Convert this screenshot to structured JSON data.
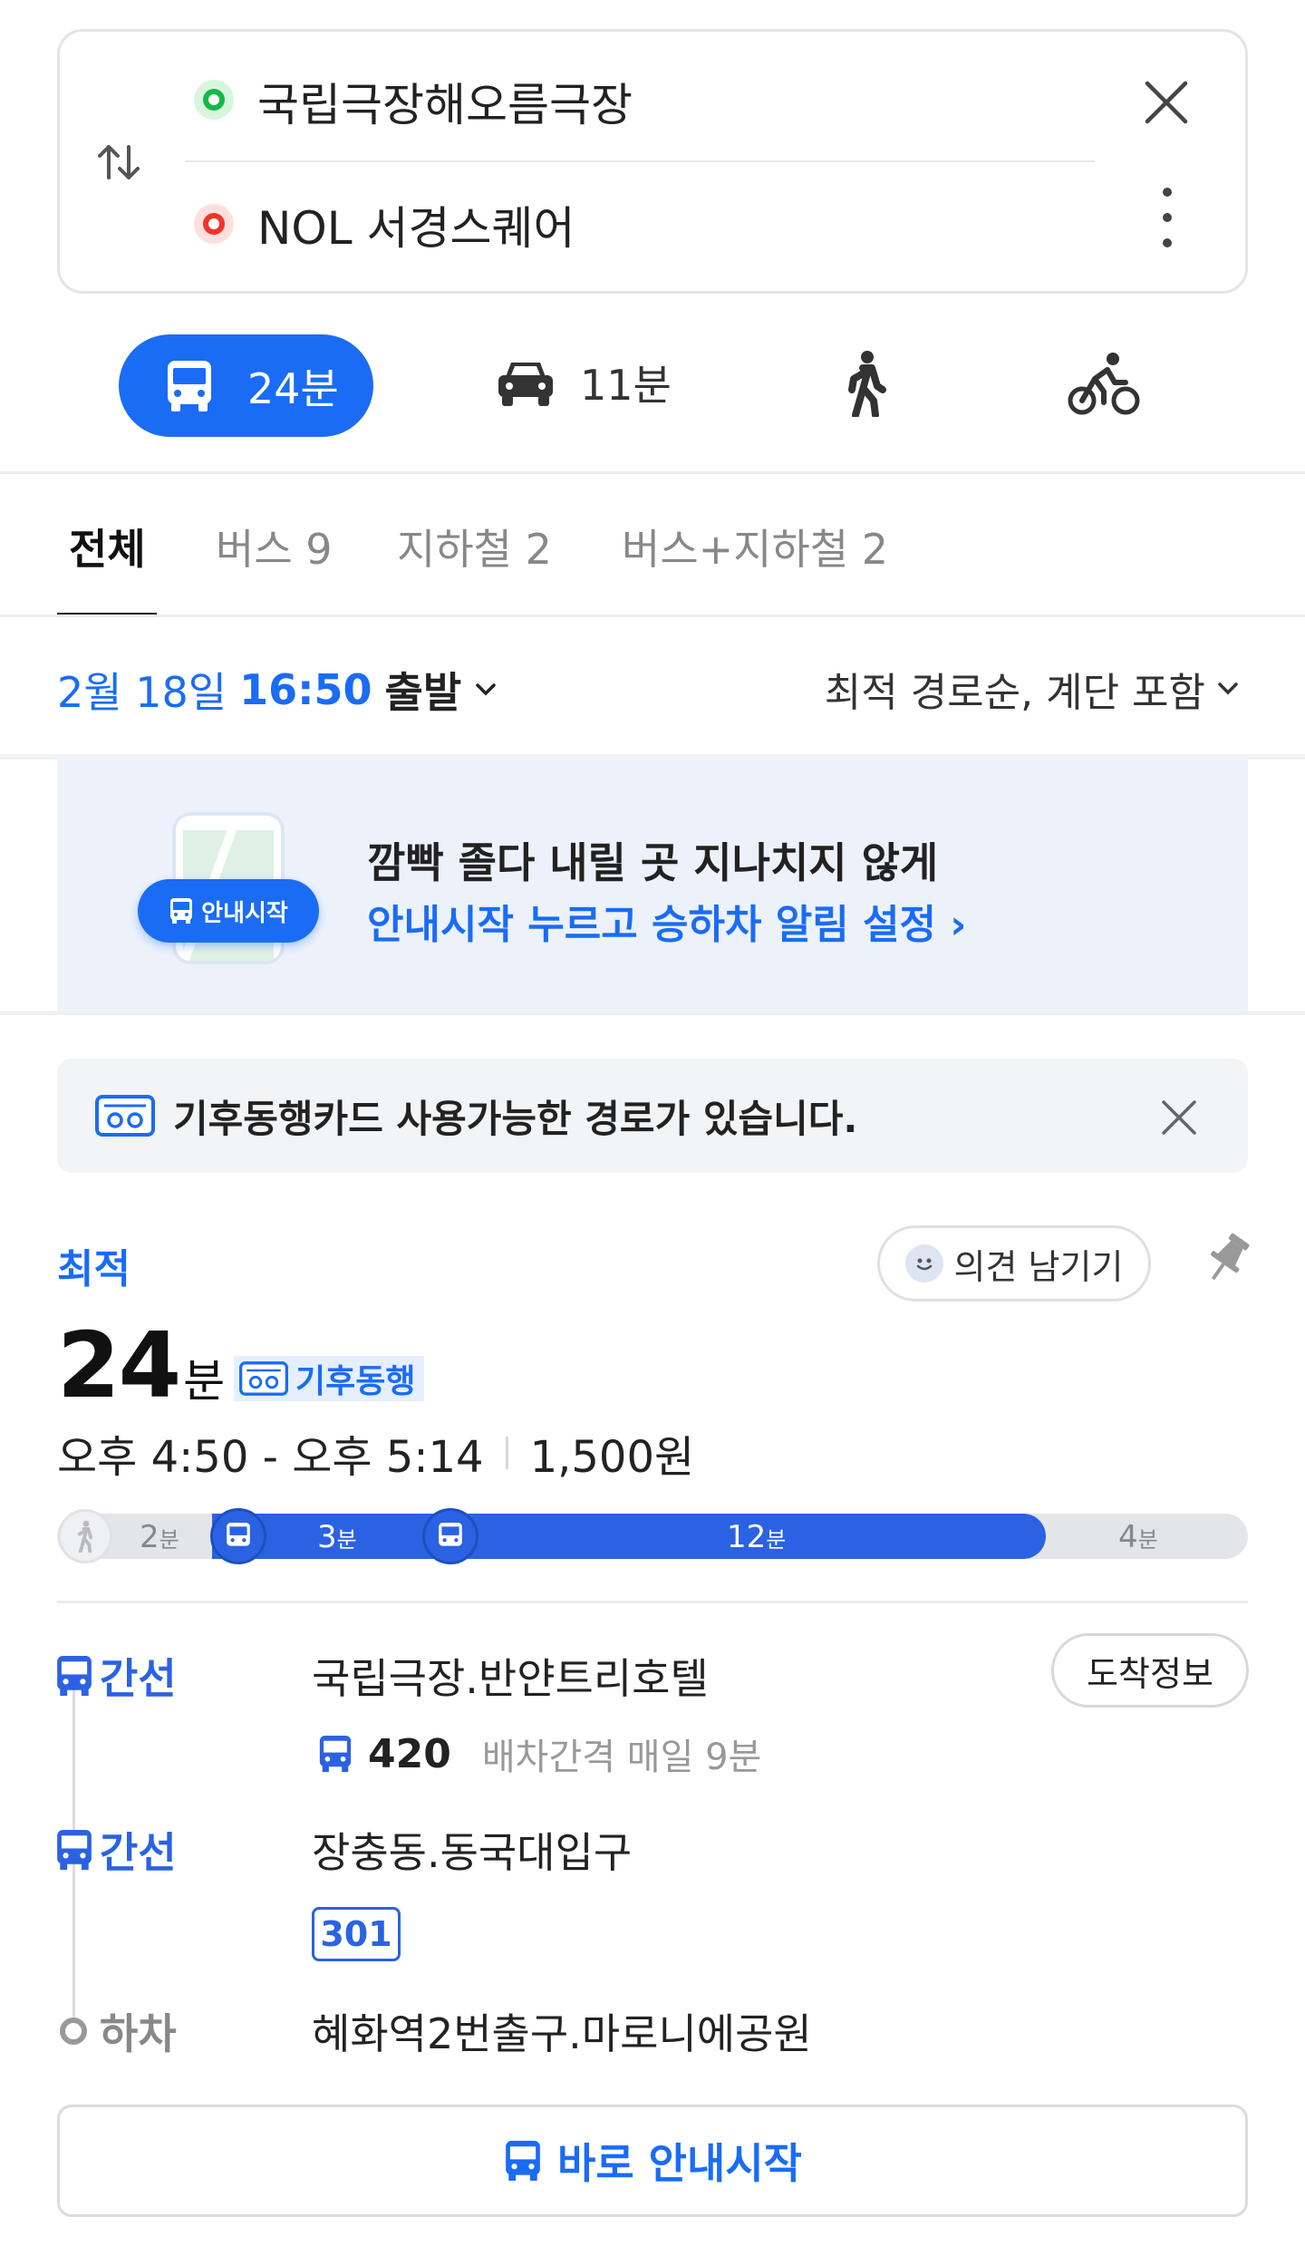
{
  "search": {
    "origin": "국립극장해오름극장",
    "destination": "NOL 서경스퀘어"
  },
  "modes": {
    "transit_time": "24분",
    "car_time": "11분"
  },
  "tabs": [
    {
      "label": "전체"
    },
    {
      "label": "버스 9"
    },
    {
      "label": "지하철 2"
    },
    {
      "label": "버스+지하철 2"
    }
  ],
  "departure": {
    "date": "2월 18일",
    "time": "16:50",
    "suffix": "출발",
    "sort": "최적 경로순, 계단 포함"
  },
  "banner": {
    "pill": "안내시작",
    "title": "깜빡 졸다 내릴 곳 지나치지 않게",
    "subtitle": "안내시작 누르고 승하차 알림 설정 ›"
  },
  "card_notice": {
    "text": "기후동행카드 사용가능한 경로가 있습니다."
  },
  "route": {
    "badge": "최적",
    "feedback": "의견 남기기",
    "duration_num": "24",
    "duration_unit": "분",
    "tag": "기후동행",
    "time_range": "오후 4:50 - 오후 5:14",
    "fare": "1,500원",
    "segments": [
      {
        "mode": "walk",
        "minutes": "2",
        "unit": "분",
        "share": 0.13
      },
      {
        "mode": "bus",
        "minutes": "3",
        "unit": "분",
        "share": 0.125
      },
      {
        "mode": "bus",
        "minutes": "12",
        "unit": "분",
        "share": 0.5
      },
      {
        "mode": "walk",
        "minutes": "4",
        "unit": "분",
        "share": 0.17
      }
    ]
  },
  "steps": [
    {
      "mode": "간선",
      "stop": "국립극장.반얀트리호텔",
      "bus_no": "420",
      "interval": "배차간격 매일 9분",
      "action": "도착정보"
    },
    {
      "mode": "간선",
      "stop": "장충동.동국대입구",
      "bus_no": "301"
    },
    {
      "mode": "하차",
      "stop": "혜화역2번출구.마로니에공원"
    }
  ],
  "start_button": "바로 안내시작",
  "colors": {
    "accent": "#1a6cf5",
    "bus": "#2b62e3",
    "origin": "#16b84a",
    "destination": "#f0352b"
  }
}
